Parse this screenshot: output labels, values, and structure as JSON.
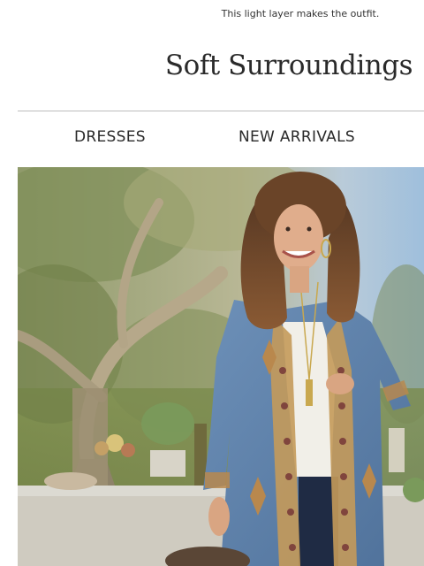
{
  "preheader": {
    "text": "This light layer makes the outfit."
  },
  "brand": {
    "logo_text": "Soft Surroundings"
  },
  "nav": {
    "items": [
      {
        "label": "DRESSES"
      },
      {
        "label": "NEW ARRIVALS"
      }
    ]
  },
  "hero": {
    "image_alt": "Woman in embroidered denim duster outdoors by a table"
  },
  "colors": {
    "text": "#2a2a2a",
    "divider": "#bdbdbd",
    "denim": "#5b7fa8",
    "sky": "#a9c6e0",
    "foliage": "#8a9a5b"
  }
}
